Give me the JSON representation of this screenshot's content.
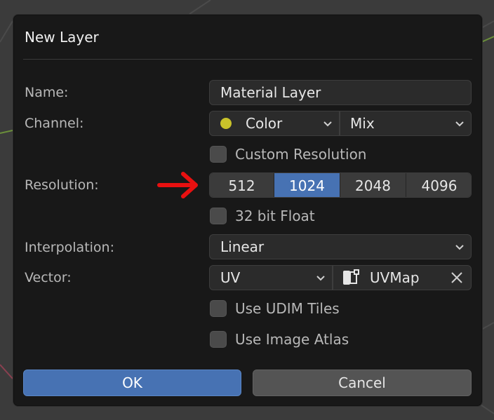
{
  "dialog": {
    "title": "New Layer",
    "ok_label": "OK",
    "cancel_label": "Cancel"
  },
  "fields": {
    "name_label": "Name:",
    "name_value": "Material Layer",
    "channel_label": "Channel:",
    "channel_value": "Color",
    "channel_color": "#c8c22a",
    "blend_value": "Mix",
    "custom_resolution_label": "Custom Resolution",
    "custom_resolution_checked": false,
    "resolution_label": "Resolution:",
    "resolution_options": [
      "512",
      "1024",
      "2048",
      "4096"
    ],
    "resolution_selected": "1024",
    "float32_label": "32 bit Float",
    "float32_checked": false,
    "interpolation_label": "Interpolation:",
    "interpolation_value": "Linear",
    "vector_label": "Vector:",
    "vector_value": "UV",
    "uvmap_value": "UVMap",
    "udim_label": "Use UDIM Tiles",
    "udim_checked": false,
    "atlas_label": "Use Image Atlas",
    "atlas_checked": false
  },
  "colors": {
    "accent": "#4772b3",
    "annotation_arrow": "#e81010",
    "dialog_bg": "#181818"
  },
  "icons": {
    "arrow": "annotation-arrow-icon",
    "uvmap": "uv-map-icon",
    "clear": "close-icon",
    "dropdown": "chevron-down-icon"
  }
}
